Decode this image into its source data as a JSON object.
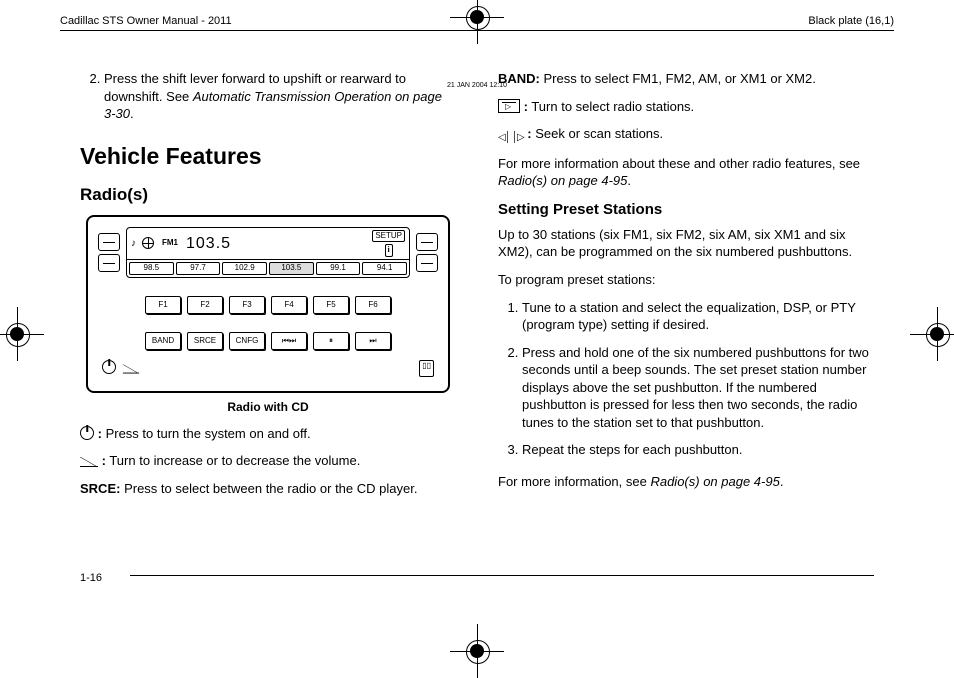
{
  "header": {
    "left": "Cadillac STS Owner Manual - 2011",
    "right": "Black plate (16,1)"
  },
  "pageNumber": "1-16",
  "left": {
    "step2": "Press the shift lever forward to upshift or rearward to downshift. See ",
    "step2_xref": "Automatic Transmission Operation on page 3-30",
    "step2_end": ".",
    "h1": "Vehicle Features",
    "h2": "Radio(s)",
    "fig_caption": "Radio with CD",
    "power_text": " Press to turn the system on and off.",
    "volume_text": " Turn to increase or to decrease the volume.",
    "srce_label": "SRCE:",
    "srce_text": " Press to select between the radio or the CD player."
  },
  "radio": {
    "timestamp": "21 JAN 2004 12:10",
    "band": "FM1",
    "frequency": "103.5",
    "setup": "SETUP",
    "info": "i",
    "presets": [
      "98.5",
      "97.7",
      "102.9",
      "103.5",
      "99.1",
      "94.1"
    ],
    "fbuttons": [
      "F1",
      "F2",
      "F3",
      "F4",
      "F5",
      "F6"
    ],
    "bottom_buttons": [
      "BAND",
      "SRCE",
      "CNFG",
      "⏮⏭",
      "⏸",
      "⏭"
    ]
  },
  "right": {
    "band_label": "BAND:",
    "band_text": " Press to select FM1, FM2, AM, or XM1 or XM2.",
    "tune_text": " Turn to select radio stations.",
    "seek_text": " Seek or scan stations.",
    "more_info": "For more information about these and other radio features, see ",
    "more_info_xref": "Radio(s) on page 4-95",
    "more_info_end": ".",
    "h3": "Setting Preset Stations",
    "p_intro": "Up to 30 stations (six FM1, six FM2, six AM, six XM1 and six XM2), can be programmed on the six numbered pushbuttons.",
    "p_to": "To program preset stations:",
    "steps": [
      "Tune to a station and select the equalization, DSP, or PTY (program type) setting if desired.",
      "Press and hold one of the six numbered pushbuttons for two seconds until a beep sounds. The set preset station number displays above the set pushbutton. If the numbered pushbutton is pressed for less then two seconds, the radio tunes to the station set to that pushbutton.",
      "Repeat the steps for each pushbutton."
    ],
    "p_more": "For more information, see ",
    "p_more_xref": "Radio(s) on page 4-95",
    "p_more_end": "."
  }
}
